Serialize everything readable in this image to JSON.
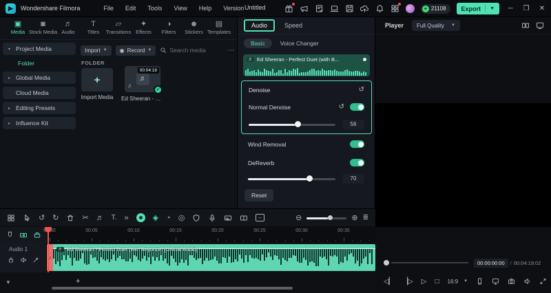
{
  "titlebar": {
    "app_name": "Wondershare Filmora",
    "menus": [
      "File",
      "Edit",
      "Tools",
      "View",
      "Help",
      "Version"
    ],
    "project_title": "Untitled",
    "coin_count": "21108",
    "export_label": "Export",
    "accent_color": "#54dfb6"
  },
  "media_panel": {
    "tabs": [
      {
        "label": "Media",
        "icon": "▣",
        "icon_name": "media-icon",
        "active": true
      },
      {
        "label": "Stock Media",
        "icon": "◙",
        "icon_name": "stock-media-icon",
        "active": false
      },
      {
        "label": "Audio",
        "icon": "♬",
        "icon_name": "audio-icon",
        "active": false
      },
      {
        "label": "Titles",
        "icon": "T",
        "icon_name": "titles-icon",
        "active": false
      },
      {
        "label": "Transitions",
        "icon": "▱",
        "icon_name": "transitions-icon",
        "active": false
      },
      {
        "label": "Effects",
        "icon": "✦",
        "icon_name": "effects-icon",
        "active": false
      },
      {
        "label": "Filters",
        "icon": "◑",
        "icon_name": "filters-icon",
        "active": false
      },
      {
        "label": "Stickers",
        "icon": "☻",
        "icon_name": "stickers-icon",
        "active": false
      },
      {
        "label": "Templates",
        "icon": "▤",
        "icon_name": "templates-icon",
        "active": false
      }
    ],
    "sidebar_items": [
      {
        "label": "Project Media",
        "arrow": "▾",
        "sub": false,
        "active": false
      },
      {
        "label": "Folder",
        "arrow": "",
        "sub": true,
        "active": true
      },
      {
        "label": "Global Media",
        "arrow": "▸",
        "sub": false,
        "active": false
      },
      {
        "label": "Cloud Media",
        "arrow": "",
        "sub": false,
        "active": false
      },
      {
        "label": "Editing Presets",
        "arrow": "▸",
        "sub": false,
        "active": false
      },
      {
        "label": "Influence Kit",
        "arrow": "▸",
        "sub": false,
        "active": false
      }
    ],
    "toolbar": {
      "import_label": "Import",
      "record_label": "Record",
      "search_placeholder": "Search media"
    },
    "folder_label": "FOLDER",
    "import_card_label": "Import Media",
    "audio_card": {
      "label": "Ed Sheeran - Per...",
      "duration": "00:04:19"
    }
  },
  "properties_panel": {
    "tab_audio": "Audio",
    "tab_speed": "Speed",
    "subtab_basic": "Basic",
    "subtab_voice": "Voice Changer",
    "clip_title": "Ed Sheeran - Perfect Duet (with B...",
    "denoise_title": "Denoise",
    "normal_denoise_label": "Normal Denoise",
    "normal_denoise_value": 56,
    "wind_label": "Wind Removal",
    "wind_on": true,
    "dereverb_label": "DeReverb",
    "dereverb_on": true,
    "dereverb_value": 70,
    "reset_label": "Reset"
  },
  "player": {
    "title": "Player",
    "quality": "Full Quality",
    "current_time": "00:00:00:00",
    "duration": "00:04:19:02",
    "aspect_ratio": "16:9"
  },
  "timeline": {
    "ruler_labels": [
      "00:00",
      "00:05",
      "00:10",
      "00:15",
      "00:20",
      "00:25",
      "00:30",
      "00:35"
    ],
    "track_name": "Audio 1",
    "clip_label": "Ed Sheeran - Perfect Duet (with Beyoncé) [Official Audio]",
    "clip_color": "#5fd6b2",
    "playhead_position": "00:00"
  }
}
